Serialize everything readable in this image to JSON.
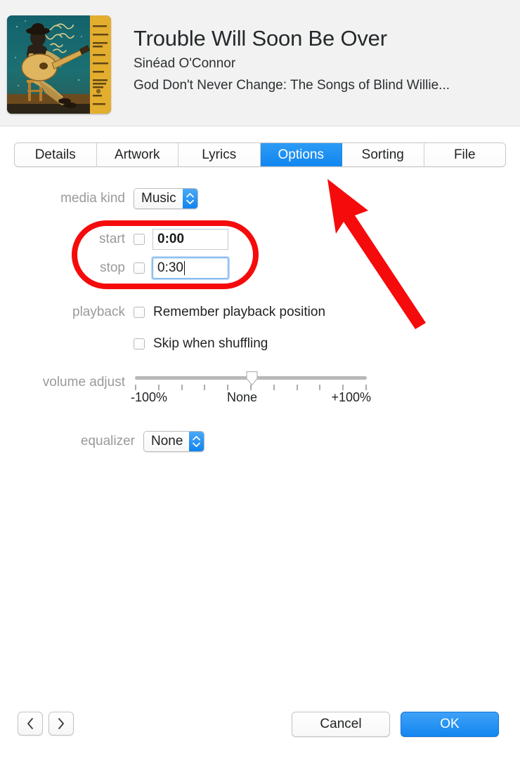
{
  "header": {
    "title": "Trouble Will Soon Be Over",
    "artist": "Sinéad O'Connor",
    "album": "God Don't Never Change: The Songs of Blind Willie...",
    "artwork_name": "album-artwork"
  },
  "tabs": [
    {
      "label": "Details",
      "active": false
    },
    {
      "label": "Artwork",
      "active": false
    },
    {
      "label": "Lyrics",
      "active": false
    },
    {
      "label": "Options",
      "active": true
    },
    {
      "label": "Sorting",
      "active": false
    },
    {
      "label": "File",
      "active": false
    }
  ],
  "options": {
    "media_kind": {
      "label": "media kind",
      "value": "Music"
    },
    "start": {
      "label": "start",
      "checked": false,
      "value": "0:00",
      "focused": false
    },
    "stop": {
      "label": "stop",
      "checked": false,
      "value": "0:30",
      "focused": true
    },
    "playback": {
      "label": "playback",
      "remember": {
        "label": "Remember playback position",
        "checked": false
      },
      "skip": {
        "label": "Skip when shuffling",
        "checked": false
      }
    },
    "volume_adjust": {
      "label": "volume adjust",
      "min_label": "-100%",
      "center_label": "None",
      "max_label": "+100%",
      "value": 0,
      "tick_count": 11
    },
    "equalizer": {
      "label": "equalizer",
      "value": "None"
    }
  },
  "footer": {
    "prev_label": "‹",
    "next_label": "›",
    "cancel_label": "Cancel",
    "ok_label": "OK"
  },
  "annotations": {
    "highlight_color": "#f50b0b",
    "oval_target": "start-stop-fields",
    "arrow_target": "tab-options"
  },
  "colors": {
    "accent": "#1186f0",
    "header_bg": "#f2f2f2",
    "label_gray": "#9a9a9a",
    "annotation_red": "#f50b0b"
  }
}
